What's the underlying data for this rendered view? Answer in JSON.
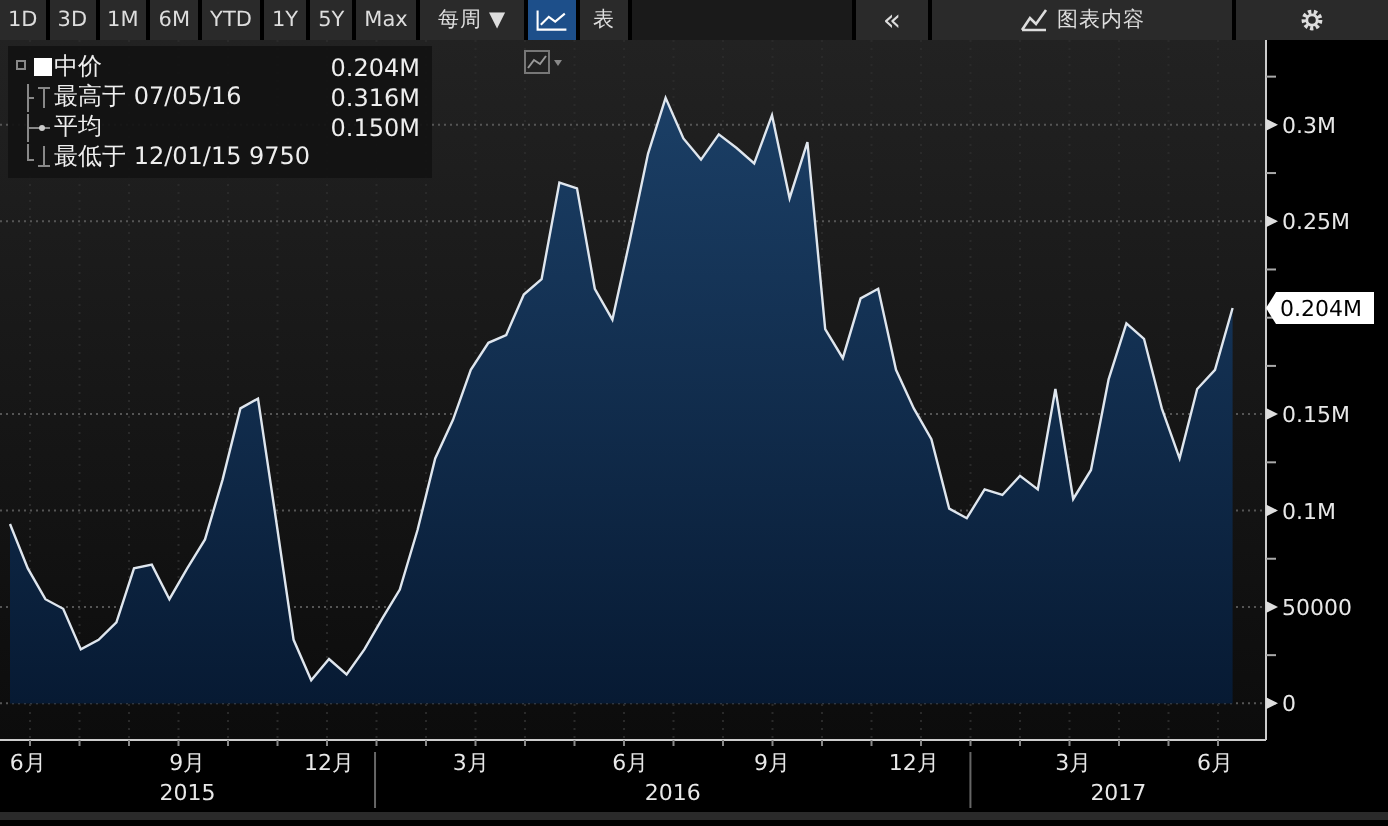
{
  "toolbar": {
    "periods": [
      {
        "label": "1D",
        "selected": false
      },
      {
        "label": "3D",
        "selected": false
      },
      {
        "label": "1M",
        "selected": false
      },
      {
        "label": "6M",
        "selected": false
      },
      {
        "label": "YTD",
        "selected": false
      },
      {
        "label": "1Y",
        "selected": false
      },
      {
        "label": "5Y",
        "selected": false
      },
      {
        "label": "Max",
        "selected": false
      }
    ],
    "frequency": "每周 ▼",
    "views": [
      {
        "kind": "chart",
        "selected": true
      },
      {
        "kind": "table",
        "label": "表",
        "selected": false
      }
    ],
    "collapse": "«",
    "content_button": "图表内容"
  },
  "legend": [
    {
      "kind": "current",
      "label": "中价",
      "value": "0.204M"
    },
    {
      "kind": "high",
      "label": "最高于 07/05/16",
      "value": "0.316M"
    },
    {
      "kind": "average",
      "label": "平均",
      "value": "0.150M"
    },
    {
      "kind": "low",
      "label": "最低于 12/01/15 9750"
    }
  ],
  "chart": {
    "chart_data": {
      "type": "area",
      "ylim": [
        -19000,
        344000
      ],
      "categories": [
        null,
        "6月",
        null,
        null,
        null,
        null,
        null,
        null,
        null,
        null,
        "9月",
        null,
        null,
        null,
        null,
        null,
        null,
        null,
        "12月",
        null,
        null,
        null,
        null,
        null,
        null,
        null,
        "3月",
        null,
        null,
        null,
        null,
        null,
        null,
        null,
        null,
        "6月",
        null,
        null,
        null,
        null,
        null,
        null,
        null,
        "9月",
        null,
        null,
        null,
        null,
        null,
        null,
        null,
        "12月",
        null,
        null,
        null,
        null,
        null,
        null,
        null,
        null,
        "3月",
        null,
        null,
        null,
        null,
        null,
        null,
        null,
        "6月",
        null
      ],
      "series": [
        {
          "color": "#dfe6ee",
          "values": [
            93000,
            70000,
            54000,
            49000,
            28000,
            33000,
            42000,
            70000,
            72000,
            54000,
            70000,
            85000,
            116000,
            153000,
            158000,
            96000,
            33000,
            12000,
            23000,
            15000,
            28000,
            44000,
            59000,
            90000,
            127000,
            147000,
            173000,
            187000,
            191000,
            212000,
            220000,
            270000,
            267000,
            215000,
            199000,
            241000,
            285000,
            314000,
            293000,
            282000,
            295000,
            288000,
            280000,
            305000,
            262000,
            291000,
            194000,
            179000,
            210000,
            215000,
            173000,
            153000,
            137000,
            101000,
            96000,
            111000,
            108000,
            118000,
            111000,
            163000,
            106000,
            121000,
            168000,
            197000,
            189000,
            153000,
            127000,
            163000,
            173000,
            205000
          ]
        }
      ],
      "yticks": [
        {
          "value": 0,
          "label": "0"
        },
        {
          "value": 50000,
          "label": "50000"
        },
        {
          "value": 100000,
          "label": "0.1M"
        },
        {
          "value": 150000,
          "label": "0.15M"
        },
        {
          "value": 250000,
          "label": "0.25M"
        },
        {
          "value": 300000,
          "label": "0.3M"
        }
      ],
      "grid": true,
      "annotations": [
        "0.204M"
      ]
    },
    "years": [
      {
        "label": "2015"
      },
      {
        "label": "2016"
      },
      {
        "label": "2017"
      }
    ]
  }
}
